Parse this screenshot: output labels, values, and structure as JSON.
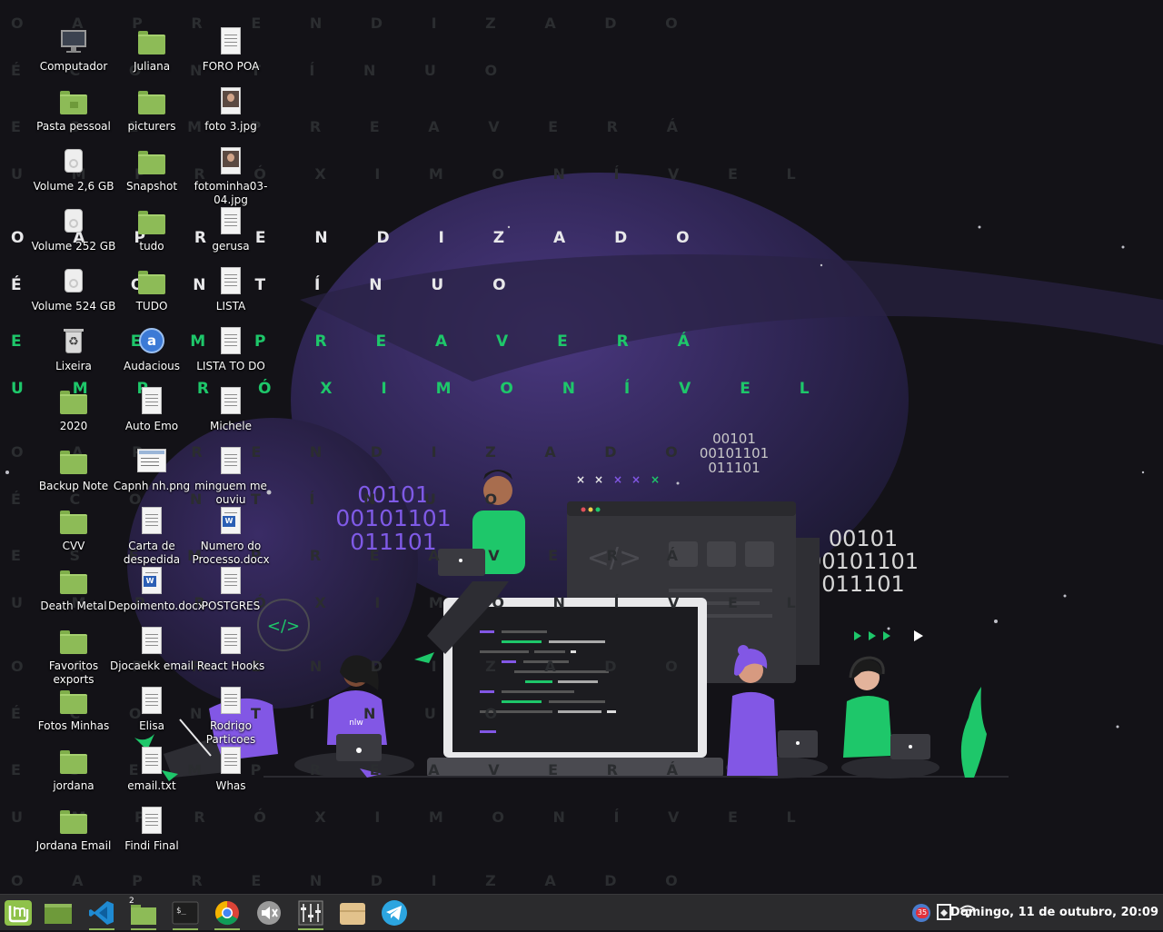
{
  "wallpaper": {
    "lines": [
      {
        "text": "O  A P R E N D I Z A D O",
        "style": "faint"
      },
      {
        "text": "É  C O N T Í N U O",
        "style": "faint"
      },
      {
        "text": "E  S E M P R E  A V E R Á",
        "style": "faint"
      },
      {
        "text": "U M  P R Ó X I M O  N Í V E L",
        "style": "faint"
      },
      {
        "text": "O  A P R E N D I Z A D O",
        "style": "white"
      },
      {
        "text": "É  C O N T Í N U O",
        "style": "white"
      },
      {
        "text": "E  S E M P R E  A V E R Á",
        "style": "green"
      },
      {
        "text": "U M  P R Ó X I M O  N Í V E L",
        "style": "green"
      },
      {
        "text": "O  A P R E N D I Z A D O",
        "style": "faint"
      },
      {
        "text": "É  C O N T Í N U O",
        "style": "faint"
      },
      {
        "text": "E  S E M P R E  A V E R Á",
        "style": "faint"
      },
      {
        "text": "U M  P R Ó X I M O  N Í V E L",
        "style": "faint"
      },
      {
        "text": "O  A P R E N D I Z A D O",
        "style": "faint"
      },
      {
        "text": "É  C O N T Í N U O",
        "style": "faint"
      },
      {
        "text": "E  S E M P R E  A V E R Á",
        "style": "faint"
      },
      {
        "text": "U M  P R Ó X I M O  N Í V E L",
        "style": "faint"
      },
      {
        "text": "O  A P R E N D I Z A D O",
        "style": "faint"
      }
    ],
    "binary_left": [
      "00101",
      "00101101",
      "011101"
    ],
    "binary_top": [
      "00101",
      "00101101",
      "011101"
    ],
    "binary_right": [
      "00101",
      "00101101",
      "011101"
    ],
    "code_tag": "</>",
    "shirt_text": "nlw",
    "accent_green": "#1ec76a",
    "accent_purple": "#8257e5"
  },
  "desktop_icons": [
    {
      "label": "Computador",
      "icon": "computer-icon"
    },
    {
      "label": "Pasta pessoal",
      "icon": "home-folder-icon"
    },
    {
      "label": "Volume 2,6 GB",
      "icon": "drive-icon"
    },
    {
      "label": "Volume 252 GB",
      "icon": "drive-icon"
    },
    {
      "label": "Volume 524 GB",
      "icon": "drive-icon"
    },
    {
      "label": "Lixeira",
      "icon": "trash-icon"
    },
    {
      "label": "2020",
      "icon": "folder-icon"
    },
    {
      "label": "Backup Note",
      "icon": "folder-icon"
    },
    {
      "label": "CVV",
      "icon": "folder-icon"
    },
    {
      "label": "Death Metal",
      "icon": "folder-icon"
    },
    {
      "label": "Favoritos exports",
      "icon": "folder-icon"
    },
    {
      "label": "Fotos Minhas",
      "icon": "folder-icon"
    },
    {
      "label": "jordana",
      "icon": "folder-icon"
    },
    {
      "label": "Jordana Email",
      "icon": "folder-icon"
    },
    {
      "label": "Juliana",
      "icon": "folder-icon"
    },
    {
      "label": "picturers",
      "icon": "folder-icon"
    },
    {
      "label": "Snapshot",
      "icon": "folder-icon"
    },
    {
      "label": "tudo",
      "icon": "folder-icon"
    },
    {
      "label": "TUDO",
      "icon": "folder-icon"
    },
    {
      "label": "Audacious",
      "icon": "audacious-icon"
    },
    {
      "label": "Auto Emo",
      "icon": "document-icon"
    },
    {
      "label": "Capnh nh.png",
      "icon": "image-icon"
    },
    {
      "label": "Carta de despedida",
      "icon": "document-icon"
    },
    {
      "label": "Depoimento.docx",
      "icon": "word-document-icon"
    },
    {
      "label": "Djocaekk email",
      "icon": "document-icon"
    },
    {
      "label": "Elisa",
      "icon": "document-icon"
    },
    {
      "label": "email.txt",
      "icon": "document-icon"
    },
    {
      "label": "Findi Final",
      "icon": "document-icon"
    },
    {
      "label": "FORO POA",
      "icon": "document-icon"
    },
    {
      "label": "foto 3.jpg",
      "icon": "image-icon"
    },
    {
      "label": "fotominha03-04.jpg",
      "icon": "image-icon"
    },
    {
      "label": "gerusa",
      "icon": "document-icon"
    },
    {
      "label": "LISTA",
      "icon": "document-icon"
    },
    {
      "label": "LISTA TO DO",
      "icon": "document-icon"
    },
    {
      "label": "Michele",
      "icon": "document-icon"
    },
    {
      "label": "minguem me ouviu",
      "icon": "document-icon"
    },
    {
      "label": "Numero do Processo.docx",
      "icon": "word-document-icon"
    },
    {
      "label": "POSTGRES",
      "icon": "document-icon"
    },
    {
      "label": "React Hooks",
      "icon": "document-icon"
    },
    {
      "label": "Rodrigo Particoes",
      "icon": "document-icon"
    },
    {
      "label": "Whas",
      "icon": "document-icon"
    }
  ],
  "taskbar": {
    "apps": [
      {
        "name": "menu",
        "icon": "mint-menu-icon"
      },
      {
        "name": "show-desktop",
        "icon": "show-desktop-icon"
      },
      {
        "name": "vscode",
        "icon": "vscode-icon"
      },
      {
        "name": "files",
        "icon": "files-icon",
        "count": "2"
      },
      {
        "name": "terminal",
        "icon": "terminal-icon"
      },
      {
        "name": "chrome",
        "icon": "chrome-icon"
      },
      {
        "name": "audio",
        "icon": "speaker-icon"
      },
      {
        "name": "mixer",
        "icon": "mixer-icon"
      },
      {
        "name": "storage",
        "icon": "box-icon"
      },
      {
        "name": "telegram",
        "icon": "telegram-icon"
      }
    ],
    "tray": {
      "notification_count": "35",
      "clock": "Domingo, 11 de outubro, 20:09"
    }
  }
}
